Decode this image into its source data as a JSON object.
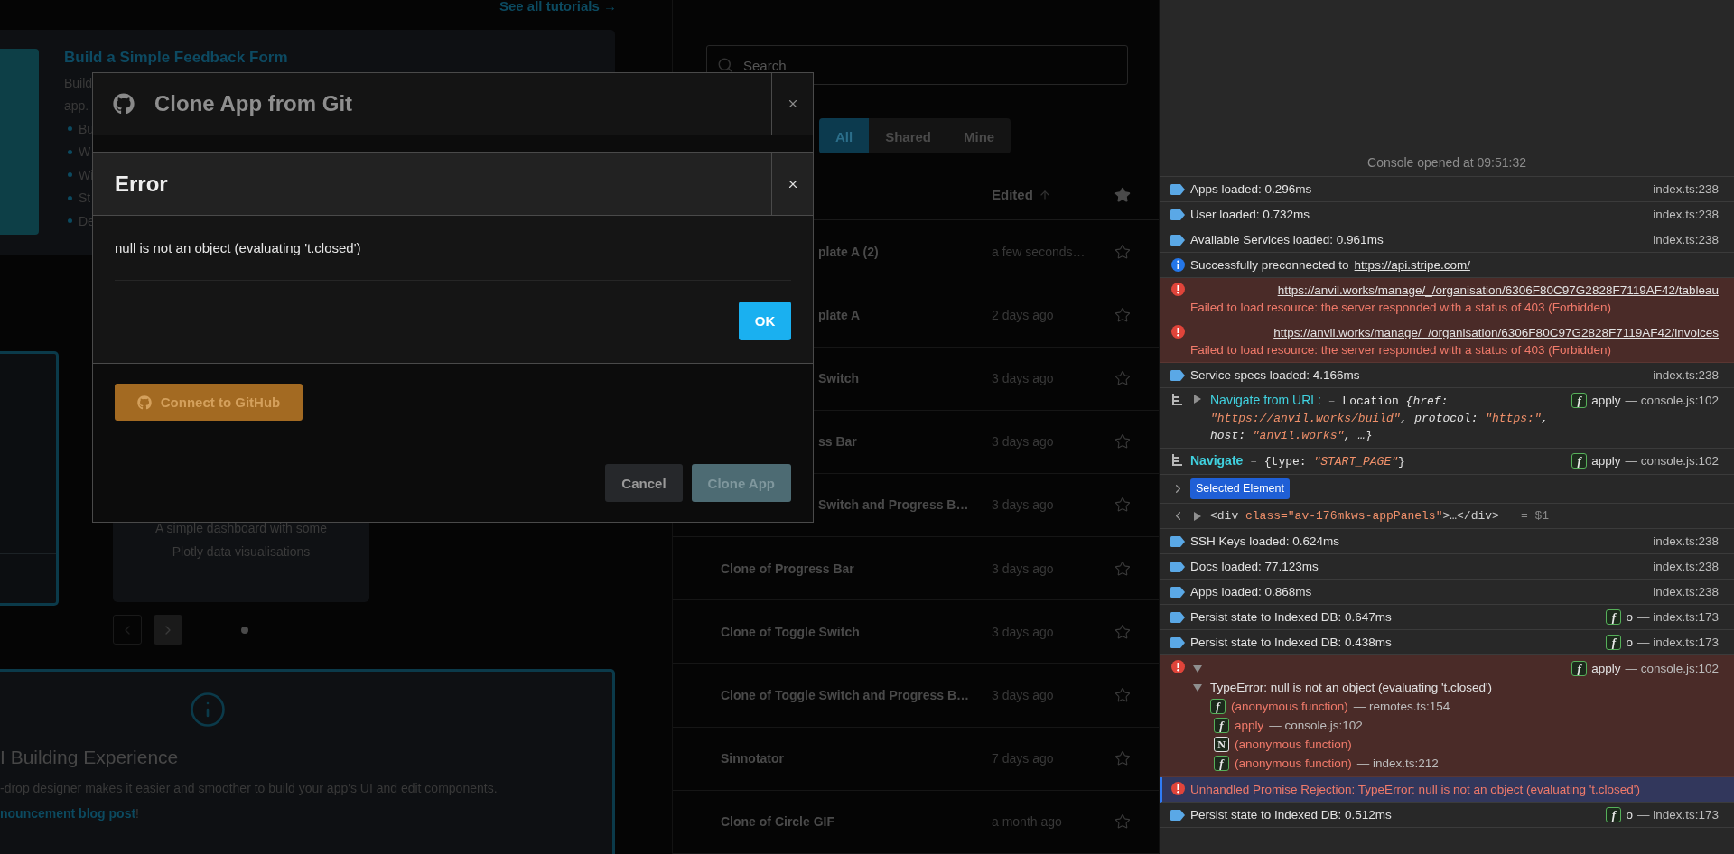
{
  "left_page": {
    "tutorials_link": "See all tutorials →",
    "tutorial_card": {
      "title": "Build a Simple Feedback Form",
      "description_lines": [
        "Build",
        "app."
      ],
      "bullets": [
        "Bu",
        "W",
        "Wi",
        "St",
        "De"
      ]
    },
    "template_card": {
      "description": "A simple dashboard with some Plotly data visualisations"
    },
    "carousel": {
      "previous": {
        "disabled": true
      },
      "next": {
        "disabled": false
      },
      "dots": [
        {
          "selected": true
        }
      ]
    },
    "info_panel": {
      "title": "I Building Experience",
      "text": "-drop designer makes it easier and smoother to build your app's UI and edit components.",
      "link": "nouncement blog post",
      "after_link": "!"
    }
  },
  "apps_panel": {
    "search": {
      "placeholder": "Search"
    },
    "filters": [
      {
        "label": "All",
        "selected": true
      },
      {
        "label": "Shared",
        "selected": false
      },
      {
        "label": "Mine",
        "selected": false
      }
    ],
    "columns": {
      "edited": "Edited"
    },
    "rows": [
      {
        "name": "plate A (2)",
        "edited": "a few seconds…",
        "starred": false
      },
      {
        "name": "plate A",
        "edited": "2 days ago",
        "starred": false
      },
      {
        "name": "Switch",
        "edited": "3 days ago",
        "starred": false
      },
      {
        "name": "ss Bar",
        "edited": "3 days ago",
        "starred": false
      },
      {
        "name": "Switch and Progress B…",
        "edited": "3 days ago",
        "starred": false
      },
      {
        "name": "Clone of Progress Bar",
        "edited": "3 days ago",
        "starred": false
      },
      {
        "name": "Clone of Toggle Switch",
        "edited": "3 days ago",
        "starred": false
      },
      {
        "name": "Clone of Toggle Switch and Progress B…",
        "edited": "3 days ago",
        "starred": false
      },
      {
        "name": "Sinnotator",
        "edited": "7 days ago",
        "starred": false
      },
      {
        "name": "Clone of Circle GIF",
        "edited": "a month ago",
        "starred": false
      }
    ]
  },
  "clone_dialog": {
    "title": "Clone App from Git",
    "connect_button": "Connect to GitHub",
    "buttons": [
      {
        "label": "Cancel",
        "kind": "secondary",
        "disabled": false
      },
      {
        "label": "Clone App",
        "kind": "primary",
        "disabled": true
      }
    ]
  },
  "error_dialog": {
    "title": "Error",
    "message": "null is not an object (evaluating 't.closed')",
    "button": "OK"
  },
  "console": {
    "opened": "Console opened at 09:51:32",
    "entries": [
      {
        "kind": "log",
        "text": "Apps loaded: 0.296ms",
        "source": "index.ts:238"
      },
      {
        "kind": "log",
        "text": "User loaded: 0.732ms",
        "source": "index.ts:238"
      },
      {
        "kind": "log",
        "text": "Available Services loaded: 0.961ms",
        "source": "index.ts:238"
      },
      {
        "kind": "info",
        "text": "Successfully preconnected to",
        "link": "https://api.stripe.com/"
      },
      {
        "kind": "resource_error",
        "url": "https://anvil.works/manage/_/organisation/6306F80C97G2828F7119AF42/tableau",
        "message": "Failed to load resource: the server responded with a status of 403 (Forbidden)"
      },
      {
        "kind": "resource_error",
        "url": "https://anvil.works/manage/_/organisation/6306F80C97G2828F7119AF42/invoices",
        "message": "Failed to load resource: the server responded with a status of 403 (Forbidden)"
      },
      {
        "kind": "log",
        "text": "Service specs loaded: 4.166ms",
        "source": "index.ts:238"
      },
      {
        "kind": "group",
        "expanded": false,
        "label": "Navigate from URL:",
        "parts": [
          {
            "kind": "sep",
            "text": "– "
          },
          {
            "kind": "plain",
            "text": "Location "
          },
          {
            "kind": "key",
            "text": "{href: "
          },
          {
            "kind": "string",
            "text": "\"https://anvil.works/build\""
          },
          {
            "kind": "key",
            "text": ", protocol: "
          },
          {
            "kind": "string",
            "text": "\"https:\""
          },
          {
            "kind": "key",
            "text": ", host: "
          },
          {
            "kind": "string",
            "text": "\"anvil.works\""
          },
          {
            "kind": "key",
            "text": ", …}"
          }
        ],
        "call": {
          "kind": "function",
          "badge": "f",
          "name": "apply",
          "source": "— console.js:102"
        }
      },
      {
        "kind": "group",
        "label": "Navigate",
        "parts": [
          {
            "kind": "sep",
            "text": "– "
          },
          {
            "kind": "plain",
            "text": "{type: "
          },
          {
            "kind": "string",
            "text": "\"START_PAGE\""
          },
          {
            "kind": "plain",
            "text": "}"
          }
        ],
        "call": {
          "kind": "function",
          "badge": "f",
          "name": "apply",
          "source": "— console.js:102"
        }
      },
      {
        "kind": "selection",
        "expanded": false,
        "badge": "Selected Element"
      },
      {
        "kind": "element",
        "expanded": false,
        "parts": [
          {
            "kind": "tag",
            "text": "<div "
          },
          {
            "kind": "attr",
            "text": "class=\"av-176mkws-appPanels\""
          },
          {
            "kind": "tag",
            "text": ">…</div>"
          }
        ],
        "result": "= $1"
      },
      {
        "kind": "log",
        "text": "SSH Keys loaded: 0.624ms",
        "source": "index.ts:238"
      },
      {
        "kind": "log",
        "text": "Docs loaded: 77.123ms",
        "source": "index.ts:238"
      },
      {
        "kind": "log",
        "text": "Apps loaded: 0.868ms",
        "source": "index.ts:238"
      },
      {
        "kind": "log",
        "text": "Persist state to Indexed DB: 0.647ms",
        "call": {
          "kind": "function",
          "badge": "f",
          "name": "o",
          "source": "— index.ts:173"
        }
      },
      {
        "kind": "log",
        "text": "Persist state to Indexed DB: 0.438ms",
        "call": {
          "kind": "function",
          "badge": "f",
          "name": "o",
          "source": "— index.ts:173"
        }
      },
      {
        "kind": "exception",
        "expanded": true,
        "call": {
          "kind": "function",
          "badge": "f",
          "name": "apply",
          "source": "— console.js:102"
        },
        "error": {
          "text": "TypeError: null is not an object (evaluating 't.closed')",
          "expanded": true
        },
        "frames": [
          {
            "kind": "function",
            "badge": "f",
            "name": "(anonymous function)",
            "source": "— remotes.ts:154"
          },
          {
            "kind": "function",
            "badge": "f",
            "name": "apply",
            "source": "— console.js:102"
          },
          {
            "kind": "native",
            "badge": "N",
            "name": "(anonymous function)"
          },
          {
            "kind": "function",
            "badge": "f",
            "name": "(anonymous function)",
            "source": "— index.ts:212"
          }
        ]
      },
      {
        "kind": "rejection",
        "text": "Unhandled Promise Rejection: TypeError: null is not an object (evaluating 't.closed')"
      },
      {
        "kind": "log",
        "text": "Persist state to Indexed DB: 0.512ms",
        "call": {
          "kind": "function",
          "badge": "f",
          "name": "o",
          "source": "— index.ts:173"
        }
      }
    ]
  }
}
